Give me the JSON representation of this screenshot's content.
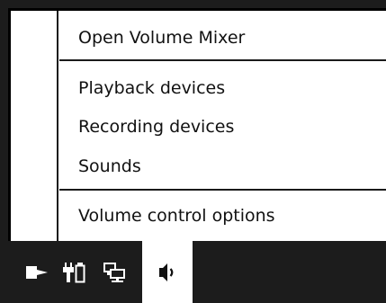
{
  "context_menu": {
    "items": [
      {
        "label": "Open Volume Mixer"
      },
      {
        "label": "Playback devices"
      },
      {
        "label": "Recording devices"
      },
      {
        "label": "Sounds"
      },
      {
        "label": "Volume control options"
      }
    ]
  },
  "taskbar": {
    "tray_icons": [
      {
        "icon": "flag-icon",
        "active": false
      },
      {
        "icon": "battery-plug-icon",
        "active": false
      },
      {
        "icon": "network-icon",
        "active": false
      },
      {
        "icon": "speaker-icon",
        "active": true
      }
    ]
  },
  "colors": {
    "menu_background": "#ffffff",
    "text": "#111111",
    "taskbar": "#1c1c1c",
    "icon": "#ffffff",
    "active_tray_background": "#ffffff"
  }
}
